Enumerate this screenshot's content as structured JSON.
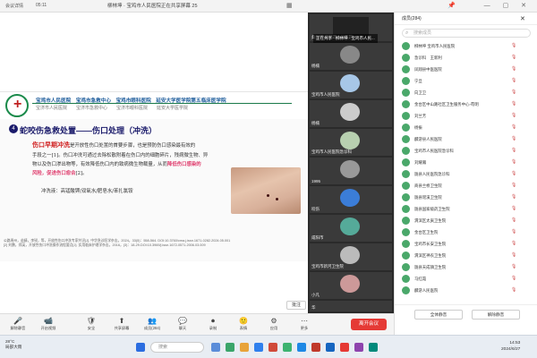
{
  "topbar": {
    "app_name": "会议详情",
    "net_status": "05:11",
    "meeting_title": "柳林坤 · 宝鸡市人民医院正在共享屏幕",
    "meeting_title_suffix": "25"
  },
  "slide": {
    "hospitals": "宝鸡市人民医院　宝鸡市急救中心　宝鸡市眼科医院　延安大学医学院第五临床医学院",
    "hospitals_sub": "宝济市人民医院　　宝济市急救中心　　宝济市眼科医院　　延安大学医学院",
    "section_num": "4",
    "section_title": "蛇咬伤急救处置——伤口处理（冲洗）",
    "para1_hl": "伤口早期冲洗",
    "para1_rest": "是开放性伤口处置的首要步骤，也是预防伤口感染最有效的",
    "para2": "手段之一[1]。伤口冲洗可通过去除松散附着在伤口内的细胞碎片，残病微生物、异",
    "para3": "物以及伤口渗出物等，有效降低伤口内的致病微生物载量，从而",
    "para3_hl": "降低伤口感染的",
    "para4_hl": "风险，促进伤口愈合",
    "para4_ref": "[2]。",
    "para5": "冲洗液：高锰酸钾/双氧水/肥皂水/苯扎氯铵",
    "refs": "公路周州，苗婧，李锐，等，开放性伤口冲洗专家共识[J]. 中华急诊医学杂志，2024，33(5)：558-564. DOI:10.3760/cma.j.issn.1671-0282.2024.05.001",
    "refs2": "[2] 刘鹏，郑英，开放性伤口冲洗操作流程要点[J]. 实用临床护理学杂志，2016，(3)：18-29.DOI:10.3969/j.issn.1672-0571.2006.03.009",
    "annotate_label": "批注"
  },
  "toolbar": {
    "buttons": [
      {
        "icon": "🎤",
        "label": "解除静音"
      },
      {
        "icon": "📹",
        "label": "开启视频"
      },
      {
        "icon": "🛡",
        "label": "安全"
      },
      {
        "icon": "⬆",
        "label": "共享屏幕"
      },
      {
        "icon": "👥",
        "label": "成员(284)"
      },
      {
        "icon": "💬",
        "label": "聊天"
      },
      {
        "icon": "⏺",
        "label": "录制"
      },
      {
        "icon": "🙂",
        "label": "表情"
      },
      {
        "icon": "⚙",
        "label": "应用"
      },
      {
        "icon": "⋯",
        "label": "更多"
      }
    ],
    "leave_label": "离开会议"
  },
  "video_strip": {
    "notice": "正在共享 · 柳林坤 · 宝鸡市人民...",
    "tiles": [
      {
        "name": "桑佐坤 宝鸡市人民医院 ..."
      },
      {
        "name": "杨楠"
      },
      {
        "name": "宝鸡市人民医院"
      },
      {
        "name": "杨楠"
      },
      {
        "name": "宝鸡市人民医院急诊科"
      },
      {
        "name": "1995"
      },
      {
        "name": "咬伤"
      },
      {
        "name": "咸阳市"
      },
      {
        "name": "宝鸡市新河卫生院"
      },
      {
        "name": "小凡"
      },
      {
        "name": "华"
      }
    ]
  },
  "sidepanel": {
    "tab_members": "成员(284)",
    "tab_search_placeholder": "搜索成员",
    "members": [
      "柳林坤 宝鸡市人民医院",
      "急诊科　王新利",
      "凤翔县中医医院",
      "宁旦",
      "向卫卫",
      "金台区中山路社区卫生服务中心-苟明",
      "刘兰芳",
      "杨振",
      "麟游县人民医院",
      "宝鸡市人民医院急诊科",
      "刘耀瀚",
      "陇县人民医院急诊科",
      "商县兰桥卫生院",
      "陇县瑶溪卫生院",
      "陇县国家级药卫生院",
      "渭滨区太寅卫生院",
      "金台区卫生院",
      "宝鸡市长安卫生院",
      "渭滨区神农卫生院",
      "陇县天成镇卫生院",
      "马红霞",
      "麟游人民医院"
    ],
    "mute_all_label": "全体静音",
    "unmute_all_label": "解除静音"
  },
  "taskbar": {
    "weather_temp": "28°C",
    "weather_text": "局部大雨",
    "search_placeholder": "搜索",
    "time": "14:53",
    "date": "2024/6/27"
  }
}
